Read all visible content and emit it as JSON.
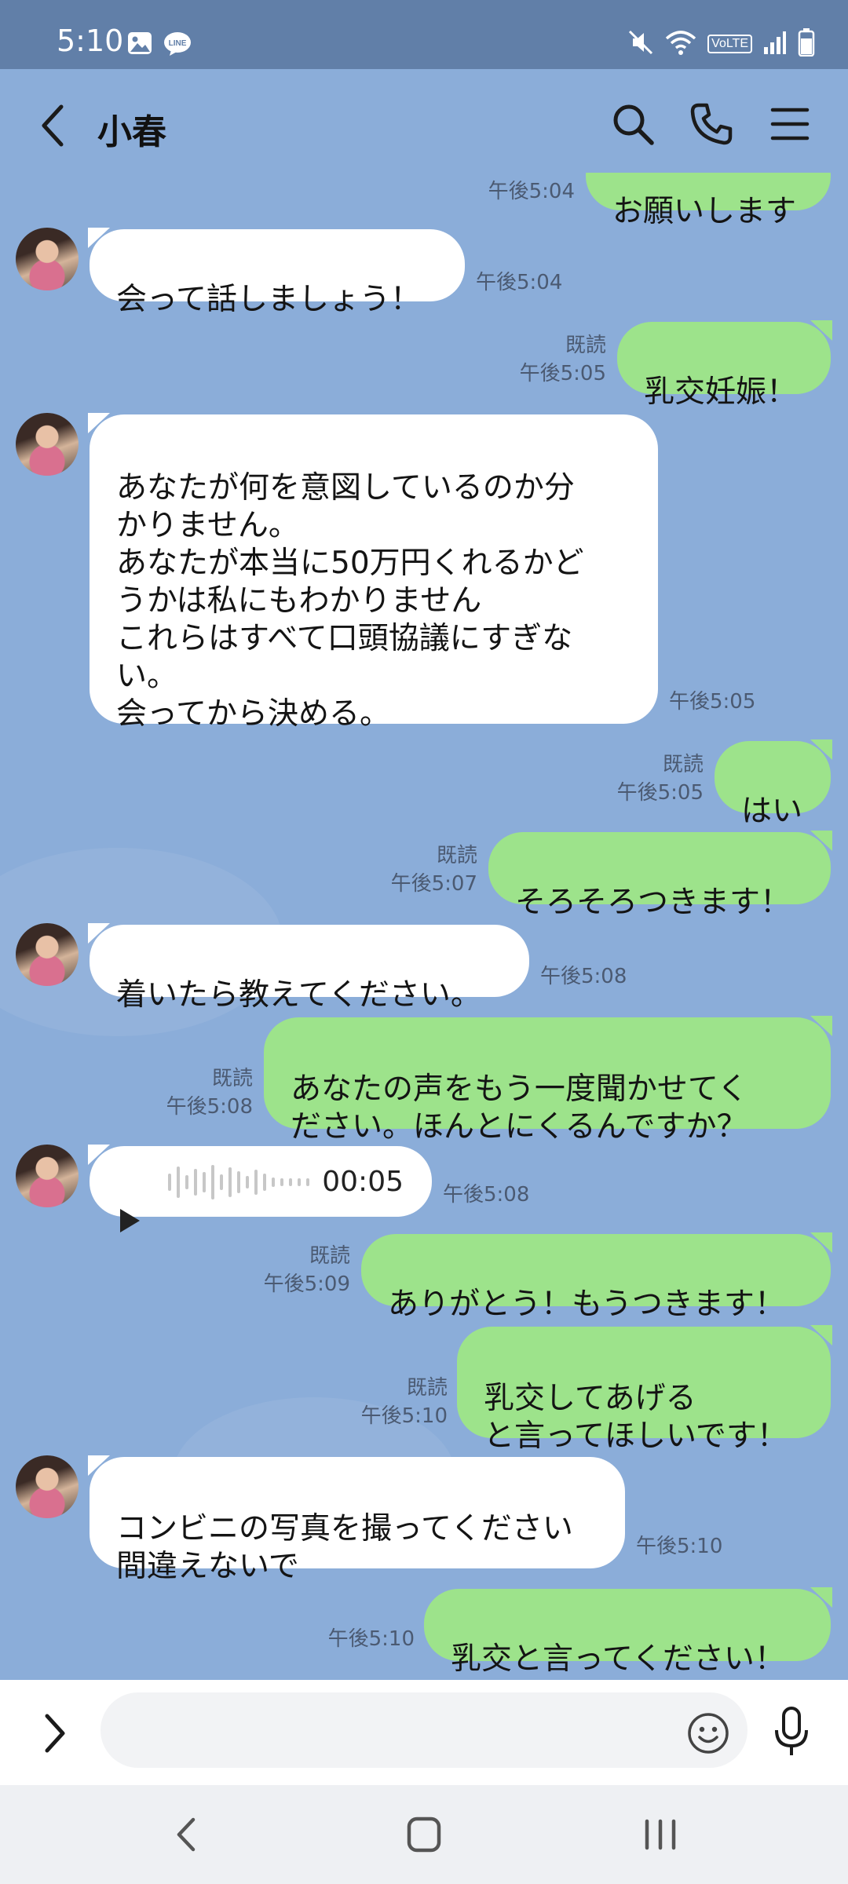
{
  "status_bar": {
    "time": "5:10",
    "left_icons": [
      "image-icon",
      "line-app-icon"
    ],
    "right_icons": [
      "mute-icon",
      "wifi-icon",
      "volte-icon",
      "signal-icon",
      "battery-icon"
    ],
    "volte_label": "VoLTE"
  },
  "header": {
    "title": "小春",
    "icons": [
      "back-icon",
      "search-icon",
      "phone-icon",
      "menu-icon"
    ]
  },
  "messages": [
    {
      "side": "out",
      "text": "お願いします",
      "time": "午後5:04",
      "read": ""
    },
    {
      "side": "in",
      "text": "会って話しましょう！",
      "time": "午後5:04"
    },
    {
      "side": "out",
      "text": "乳交妊娠！",
      "time": "午後5:05",
      "read": "既読"
    },
    {
      "side": "in",
      "text": "あなたが何を意図しているのか分\nかりません。\nあなたが本当に50万円くれるかど\nうかは私にもわかりません\nこれらはすべて口頭協議にすぎな\nい。\n会ってから決める。",
      "time": "午後5:05"
    },
    {
      "side": "out",
      "text": "はい",
      "time": "午後5:05",
      "read": "既読"
    },
    {
      "side": "out",
      "text": "そろそろつきます！",
      "time": "午後5:07",
      "read": "既読"
    },
    {
      "side": "in",
      "text": "着いたら教えてください。",
      "time": "午後5:08"
    },
    {
      "side": "out",
      "text": "あなたの声をもう一度聞かせてく\nださい。ほんとにくるんですか？",
      "time": "午後5:08",
      "read": "既読"
    },
    {
      "side": "in",
      "type": "voice",
      "duration": "00:05",
      "time": "午後5:08"
    },
    {
      "side": "out",
      "text": "ありがとう！もうつきます！",
      "time": "午後5:09",
      "read": "既読"
    },
    {
      "side": "out",
      "text": "乳交してあげる\nと言ってほしいです！",
      "time": "午後5:10",
      "read": "既読"
    },
    {
      "side": "in",
      "text": "コンビニの写真を撮ってください\n間違えないで",
      "time": "午後5:10"
    },
    {
      "side": "out",
      "text": "乳交と言ってください！",
      "time": "午後5:10",
      "read": ""
    }
  ],
  "input_bar": {
    "placeholder": "",
    "icons": [
      "chevron-right-icon",
      "emoji-icon",
      "mic-icon"
    ]
  },
  "nav_bar": {
    "icons": [
      "nav-back-icon",
      "nav-home-icon",
      "nav-recents-icon"
    ]
  },
  "colors": {
    "chat_bg": "#8badd9",
    "status_bg": "#617fa8",
    "bubble_out": "#9de38b",
    "bubble_in": "#ffffff"
  }
}
